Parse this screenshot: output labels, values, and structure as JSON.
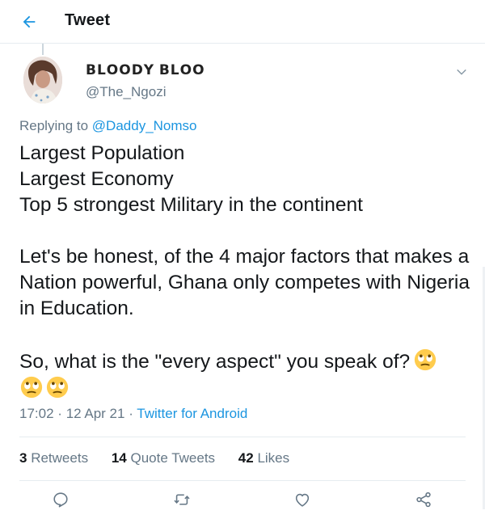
{
  "header": {
    "title": "Tweet",
    "back_icon": "arrow-left-icon"
  },
  "tweet": {
    "display_name": "𝗕𝗟𝗢𝗢𝗗𝗬 𝗕𝗟𝗢𝗢",
    "handle": "@The_Ngozi",
    "replying_prefix": "Replying to",
    "replying_to": "@Daddy_Nomso",
    "text_lines_1": [
      "Largest Population",
      "Largest Economy",
      "Top 5 strongest Military in the continent"
    ],
    "text_para_2": "Let's be honest, of the 4 major factors that makes a Nation powerful, Ghana only competes with Nigeria in Education.",
    "text_para_3": "So, what is the \"every aspect\" you speak of?",
    "emoji": "face-with-rolling-eyes",
    "time": "17:02",
    "date": "12 Apr 21",
    "source": "Twitter for Android",
    "dot": "·"
  },
  "stats": {
    "retweets_count": "3",
    "retweets_label": "Retweets",
    "quotes_count": "14",
    "quotes_label": "Quote Tweets",
    "likes_count": "42",
    "likes_label": "Likes"
  },
  "colors": {
    "accent": "#1b95e0",
    "muted": "#657786",
    "divider": "#e6ecf0"
  }
}
